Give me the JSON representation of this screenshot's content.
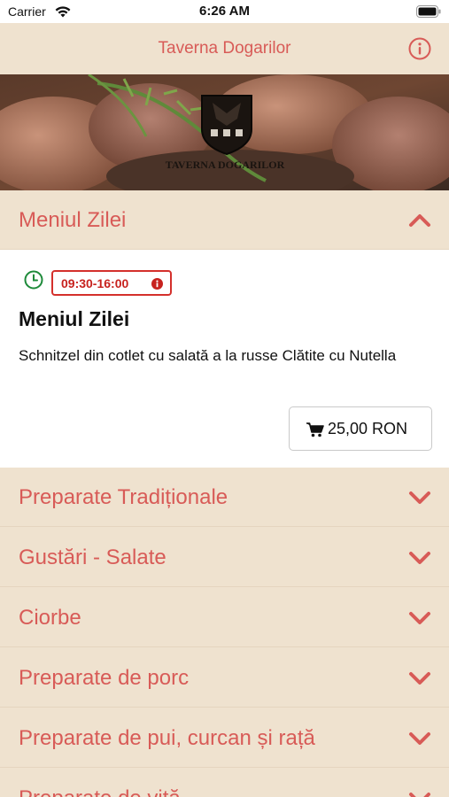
{
  "status_bar": {
    "carrier": "Carrier",
    "time": "6:26 AM"
  },
  "nav": {
    "title": "Taverna Dogarilor"
  },
  "hero": {
    "logo_text": "TAVERNA DOGARILOR"
  },
  "open_section": {
    "header": "Meniul Zilei",
    "hours": "09:30-16:00",
    "item_title": "Meniul Zilei",
    "item_description": "Schnitzel din cotlet cu salată a la russe Clătite cu Nutella",
    "price": "25,00 RON"
  },
  "categories": [
    {
      "label": "Preparate Tradiționale"
    },
    {
      "label": "Gustări - Salate"
    },
    {
      "label": "Ciorbe"
    },
    {
      "label": "Preparate de porc"
    },
    {
      "label": "Preparate de pui, curcan și rață"
    },
    {
      "label": "Preparate de vită"
    }
  ],
  "colors": {
    "accent": "#d85b57",
    "background": "#efe2cf",
    "badge_red": "#d4302c",
    "clock_green": "#1e8a3a"
  }
}
